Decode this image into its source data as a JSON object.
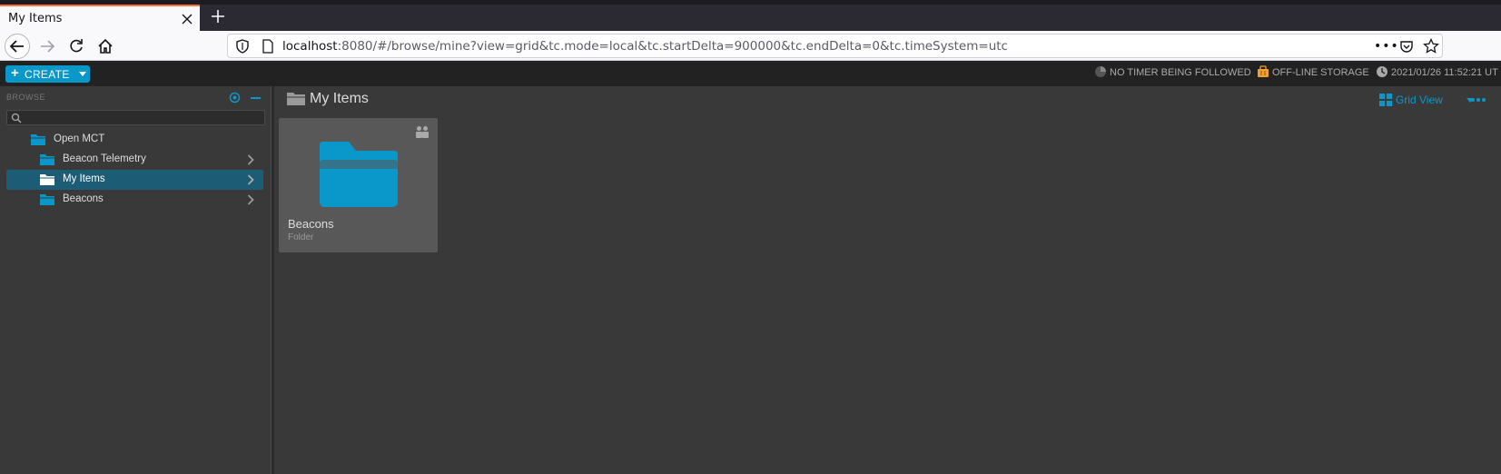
{
  "browser": {
    "tab_title": "My Items",
    "url_host": "localhost",
    "url_rest": ":8080/#/browse/mine?view=grid&tc.mode=local&tc.startDelta=900000&tc.endDelta=0&tc.timeSystem=utc",
    "url_more": "•••"
  },
  "header": {
    "create_label": "CREATE",
    "timer_status": "NO TIMER BEING FOLLOWED",
    "storage_status": "OFF-LINE STORAGE",
    "clock": "2021/01/26 11:52:21 UT"
  },
  "sidebar": {
    "browse_label": "BROWSE",
    "search_placeholder": "",
    "items": [
      {
        "label": "Open MCT"
      },
      {
        "label": "Beacon Telemetry"
      },
      {
        "label": "My Items"
      },
      {
        "label": "Beacons"
      }
    ]
  },
  "main": {
    "title": "My Items",
    "view_label": "Grid View",
    "grid_items": [
      {
        "name": "Beacons",
        "type": "Folder"
      }
    ]
  },
  "colors": {
    "accent": "#0a97c9",
    "selected_row": "#1c5c74",
    "folder_blue": "#0a97c9"
  },
  "icons": [
    "back-icon",
    "forward-icon",
    "reload-icon",
    "home-icon",
    "shield-icon",
    "page-icon",
    "pocket-icon",
    "star-icon",
    "timer-icon",
    "storage-icon",
    "clock-icon",
    "locate-icon",
    "search-icon",
    "folder-icon",
    "chevron-right-icon",
    "grid-view-icon",
    "more-icon",
    "shared-people-icon"
  ]
}
